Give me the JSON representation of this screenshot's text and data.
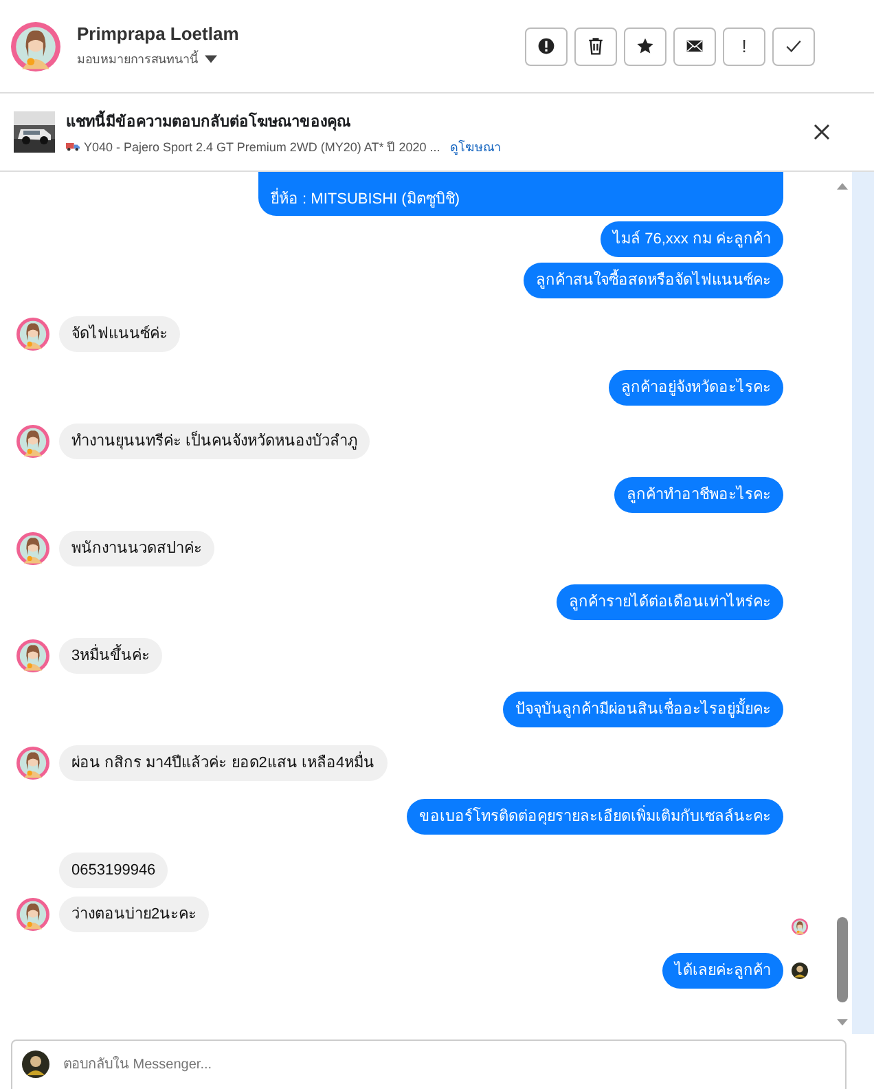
{
  "contact": {
    "name": "Primprapa Loetlam",
    "assign_label": "มอบหมายการสนทนานี้"
  },
  "actions": [
    {
      "kind": "report"
    },
    {
      "kind": "delete"
    },
    {
      "kind": "star"
    },
    {
      "kind": "mail"
    },
    {
      "kind": "text",
      "label": "!"
    },
    {
      "kind": "done"
    }
  ],
  "ad_banner": {
    "title": "แชทนี้มีข้อความตอบกลับต่อโฆษณาของคุณ",
    "ad_text": "Y040 - Pajero Sport 2.4 GT Premium 2WD (MY20) AT* ปี 2020 ...",
    "link": "ดูโฆษณา"
  },
  "messages": [
    {
      "kind": "outgoing",
      "text": "ยี่ห้อ : MITSUBISHI (มิตซูบิชิ)",
      "cut_top": true
    },
    {
      "kind": "outgoing",
      "text": "ไมล์  76,xxx   กม  ค่ะลูกค้า"
    },
    {
      "kind": "outgoing",
      "text": "ลูกค้าสนใจซื้อสดหรือจัดไฟแนนซ์คะ"
    },
    {
      "kind": "incoming",
      "text": "จัดไฟแนนซ์ค่ะ",
      "avatar": true
    },
    {
      "kind": "outgoing",
      "text": "ลูกค้าอยู่จังหวัดอะไรคะ"
    },
    {
      "kind": "incoming",
      "text": "ทำงานยุนนทรีค่ะ เป็นคนจังหวัดหนองบัวลำภู",
      "avatar": true
    },
    {
      "kind": "outgoing",
      "text": "ลูกค้าทำอาชีพอะไรคะ"
    },
    {
      "kind": "incoming",
      "text": "พนักงานนวดสปาค่ะ",
      "avatar": true
    },
    {
      "kind": "outgoing",
      "text": "ลูกค้ารายได้ต่อเดือนเท่าไหร่คะ"
    },
    {
      "kind": "incoming",
      "text": "3หมื่นขึ้นค่ะ",
      "avatar": true
    },
    {
      "kind": "outgoing",
      "text": "ปัจจุบันลูกค้ามีผ่อนสินเชื่ออะไรอยู่มั้ยคะ"
    },
    {
      "kind": "incoming",
      "text": "ผ่อน กสิกร มา4ปีแล้วค่ะ ยอด2แสน เหลือ4หมื่น",
      "avatar": true
    },
    {
      "kind": "outgoing",
      "text": "ขอเบอร์โทรติดต่อคุยรายละเอียดเพิ่มเติมกับเซลล์นะคะ"
    },
    {
      "kind": "incoming",
      "text": "0653199946",
      "avatar": false
    },
    {
      "kind": "incoming",
      "text": "ว่างตอนบ่าย2นะคะ",
      "avatar": true,
      "seen": true
    },
    {
      "kind": "outgoing",
      "text": "ได้เลยค่ะลูกค้า",
      "seen": true
    }
  ],
  "composer": {
    "placeholder": "ตอบกลับใน Messenger..."
  }
}
